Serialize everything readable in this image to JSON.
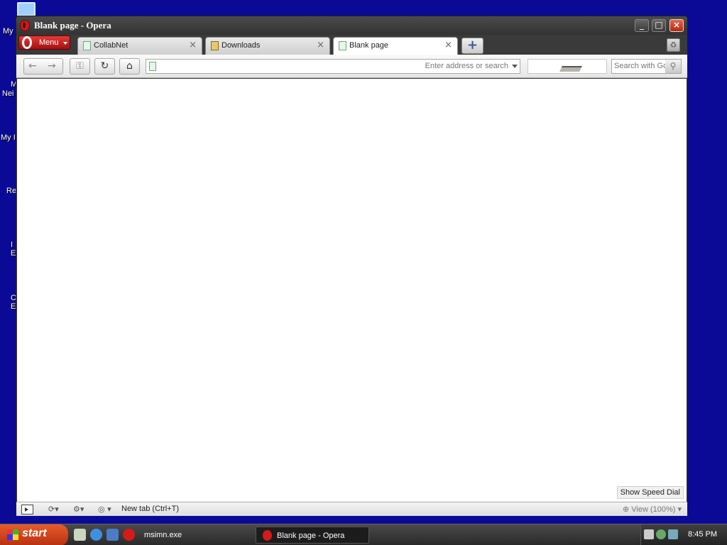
{
  "desktop": {
    "labels": [
      "My",
      "M",
      "Nei",
      "My I",
      "Re",
      "I",
      "E",
      "C",
      "E"
    ]
  },
  "window": {
    "title": "Blank page - Opera",
    "controls": {
      "minimize": "_",
      "maximize": "□",
      "close": "×"
    }
  },
  "menu": {
    "label": "Menu"
  },
  "tabs": [
    {
      "label": "CollabNet",
      "close": "×"
    },
    {
      "label": "Downloads",
      "close": "×"
    },
    {
      "label": "Blank page",
      "close": "×"
    }
  ],
  "new_tab": {
    "label": "+"
  },
  "toolbar": {
    "back": "←",
    "forward": "→",
    "wand": "⚿",
    "reload": "↻",
    "home": "⌂",
    "address_placeholder": "Enter address or search",
    "search_placeholder": "Search with Google"
  },
  "content": {
    "speed_dial_label": "Show Speed Dial"
  },
  "statusbar": {
    "new_tab_label": "New tab (Ctrl+T)",
    "view_label": "View (100%)"
  },
  "taskbar": {
    "start_label": "start",
    "tasks": [
      {
        "label": "msimn.exe"
      },
      {
        "label": "Blank page - Opera"
      }
    ],
    "clock": "8:45 PM"
  },
  "colors": {
    "desktop": "#0a0a96",
    "opera_red": "#cc1b1b",
    "start_orange": "#e95a2a"
  }
}
